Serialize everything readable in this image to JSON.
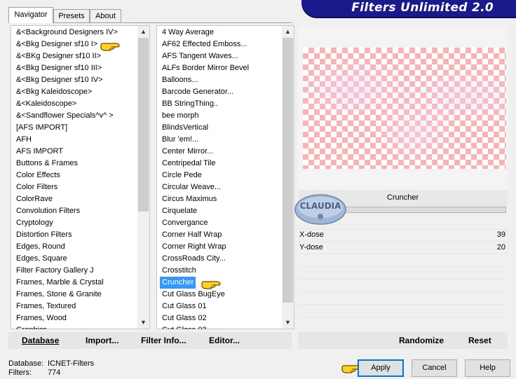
{
  "tabs": [
    {
      "label": "Navigator",
      "active": true
    },
    {
      "label": "Presets",
      "active": false
    },
    {
      "label": "About",
      "active": false
    }
  ],
  "banner": {
    "title": "Filters Unlimited 2.0",
    "color": "#1a1a8c"
  },
  "categories": {
    "items": [
      "&<Background Designers IV>",
      "&<Bkg Designer sf10 I>",
      "&<BKg Designer sf10 II>",
      "&<Bkg Designer sf10 III>",
      "&<Bkg Designer sf10 IV>",
      "&<Bkg Kaleidoscope>",
      "&<Kaleidoscope>",
      "&<Sandflower Specials^v^ >",
      "[AFS IMPORT]",
      "AFH",
      "AFS IMPORT",
      "Buttons & Frames",
      "Color Effects",
      "Color Filters",
      "ColorRave",
      "Convolution Filters",
      "Cryptology",
      "Distortion Filters",
      "Edges, Round",
      "Edges, Square",
      "Filter Factory Gallery J",
      "Frames, Marble & Crystal",
      "Frames, Stone & Granite",
      "Frames, Textured",
      "Frames, Wood"
    ],
    "partial_item": "Graphics"
  },
  "filters": {
    "items": [
      "4 Way Average",
      "AF62 Effected Emboss...",
      "AFS Tangent Waves...",
      "ALFs Border Mirror Bevel",
      "Balloons...",
      "Barcode Generator...",
      "BB StringThing..",
      "bee morph",
      "BlindsVertical",
      "Blur 'em!...",
      "Center Mirror...",
      "Centripedal Tile",
      "Circle Pede",
      "Circular Weave...",
      "Circus Maximus",
      "Cirquelate",
      "Convergance",
      "Corner Half Wrap",
      "Corner Right Wrap",
      "CrossRoads City...",
      "Crosstitch",
      "Cruncher",
      "Cut Glass  BugEye",
      "Cut Glass 01",
      "Cut Glass 02"
    ],
    "partial_item": "Cut Glass 03",
    "selected": "Cruncher"
  },
  "preview": {
    "filter_name": "Cruncher",
    "watermark": "CLAUDIA",
    "checker_color": "#f9b3b3"
  },
  "params": [
    {
      "label": "X-dose",
      "value": "39"
    },
    {
      "label": "Y-dose",
      "value": "20"
    }
  ],
  "toolbar": {
    "database": "Database",
    "import": "Import...",
    "filter_info": "Filter Info...",
    "editor": "Editor...",
    "randomize": "Randomize",
    "reset": "Reset"
  },
  "status": {
    "database_label": "Database:",
    "database_value": "ICNET-Filters",
    "filters_label": "Filters:",
    "filters_value": "774"
  },
  "buttons": {
    "apply": "Apply",
    "cancel": "Cancel",
    "help": "Help"
  },
  "accent_color": "#3399ff"
}
